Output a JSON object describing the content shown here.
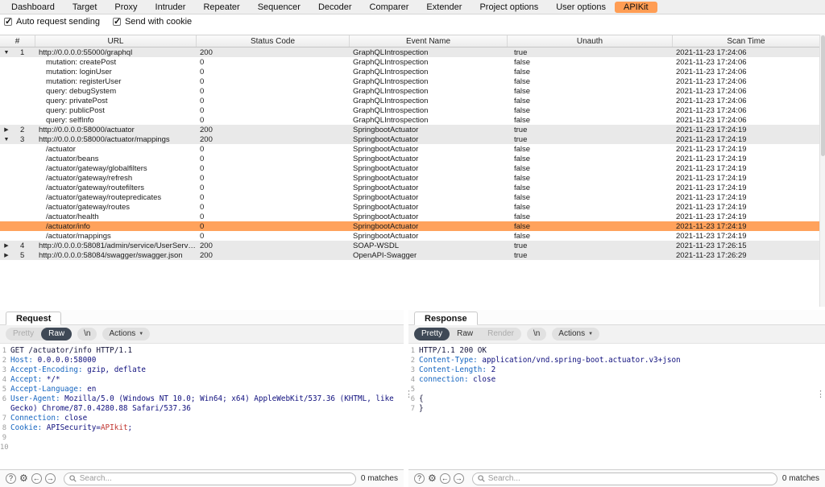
{
  "menu": {
    "tabs": [
      {
        "label": "Dashboard",
        "selected": false
      },
      {
        "label": "Target",
        "selected": false
      },
      {
        "label": "Proxy",
        "selected": false
      },
      {
        "label": "Intruder",
        "selected": false
      },
      {
        "label": "Repeater",
        "selected": false
      },
      {
        "label": "Sequencer",
        "selected": false
      },
      {
        "label": "Decoder",
        "selected": false
      },
      {
        "label": "Comparer",
        "selected": false
      },
      {
        "label": "Extender",
        "selected": false
      },
      {
        "label": "Project options",
        "selected": false
      },
      {
        "label": "User options",
        "selected": false
      },
      {
        "label": "APIKit",
        "selected": true
      }
    ]
  },
  "options": [
    {
      "label": "Auto request sending",
      "checked": true
    },
    {
      "label": "Send with cookie",
      "checked": true
    }
  ],
  "table": {
    "columns": [
      "#",
      "URL",
      "Status Code",
      "Event Name",
      "Unauth",
      "Scan Time"
    ],
    "rows": [
      {
        "expand": "down",
        "num": "1",
        "url": "http://0.0.0.0:55000/graphql",
        "status": "200",
        "event": "GraphQLIntrospection",
        "unauth": "true",
        "time": "2021-11-23 17:24:06",
        "kind": "parent"
      },
      {
        "expand": "",
        "num": "",
        "url": "mutation: createPost",
        "status": "0",
        "event": "GraphQLIntrospection",
        "unauth": "false",
        "time": "2021-11-23 17:24:06",
        "kind": "child"
      },
      {
        "expand": "",
        "num": "",
        "url": "mutation: loginUser",
        "status": "0",
        "event": "GraphQLIntrospection",
        "unauth": "false",
        "time": "2021-11-23 17:24:06",
        "kind": "child"
      },
      {
        "expand": "",
        "num": "",
        "url": "mutation: registerUser",
        "status": "0",
        "event": "GraphQLIntrospection",
        "unauth": "false",
        "time": "2021-11-23 17:24:06",
        "kind": "child"
      },
      {
        "expand": "",
        "num": "",
        "url": "query: debugSystem",
        "status": "0",
        "event": "GraphQLIntrospection",
        "unauth": "false",
        "time": "2021-11-23 17:24:06",
        "kind": "child"
      },
      {
        "expand": "",
        "num": "",
        "url": "query: privatePost",
        "status": "0",
        "event": "GraphQLIntrospection",
        "unauth": "false",
        "time": "2021-11-23 17:24:06",
        "kind": "child"
      },
      {
        "expand": "",
        "num": "",
        "url": "query: publicPost",
        "status": "0",
        "event": "GraphQLIntrospection",
        "unauth": "false",
        "time": "2021-11-23 17:24:06",
        "kind": "child"
      },
      {
        "expand": "",
        "num": "",
        "url": "query: selfInfo",
        "status": "0",
        "event": "GraphQLIntrospection",
        "unauth": "false",
        "time": "2021-11-23 17:24:06",
        "kind": "child"
      },
      {
        "expand": "right",
        "num": "2",
        "url": "http://0.0.0.0:58000/actuator",
        "status": "200",
        "event": "SpringbootActuator",
        "unauth": "true",
        "time": "2021-11-23 17:24:19",
        "kind": "parent"
      },
      {
        "expand": "down",
        "num": "3",
        "url": "http://0.0.0.0:58000/actuator/mappings",
        "status": "200",
        "event": "SpringbootActuator",
        "unauth": "true",
        "time": "2021-11-23 17:24:19",
        "kind": "parent"
      },
      {
        "expand": "",
        "num": "",
        "url": "/actuator",
        "status": "0",
        "event": "SpringbootActuator",
        "unauth": "false",
        "time": "2021-11-23 17:24:19",
        "kind": "child"
      },
      {
        "expand": "",
        "num": "",
        "url": "/actuator/beans",
        "status": "0",
        "event": "SpringbootActuator",
        "unauth": "false",
        "time": "2021-11-23 17:24:19",
        "kind": "child"
      },
      {
        "expand": "",
        "num": "",
        "url": "/actuator/gateway/globalfilters",
        "status": "0",
        "event": "SpringbootActuator",
        "unauth": "false",
        "time": "2021-11-23 17:24:19",
        "kind": "child"
      },
      {
        "expand": "",
        "num": "",
        "url": "/actuator/gateway/refresh",
        "status": "0",
        "event": "SpringbootActuator",
        "unauth": "false",
        "time": "2021-11-23 17:24:19",
        "kind": "child"
      },
      {
        "expand": "",
        "num": "",
        "url": "/actuator/gateway/routefilters",
        "status": "0",
        "event": "SpringbootActuator",
        "unauth": "false",
        "time": "2021-11-23 17:24:19",
        "kind": "child"
      },
      {
        "expand": "",
        "num": "",
        "url": "/actuator/gateway/routepredicates",
        "status": "0",
        "event": "SpringbootActuator",
        "unauth": "false",
        "time": "2021-11-23 17:24:19",
        "kind": "child"
      },
      {
        "expand": "",
        "num": "",
        "url": "/actuator/gateway/routes",
        "status": "0",
        "event": "SpringbootActuator",
        "unauth": "false",
        "time": "2021-11-23 17:24:19",
        "kind": "child"
      },
      {
        "expand": "",
        "num": "",
        "url": "/actuator/health",
        "status": "0",
        "event": "SpringbootActuator",
        "unauth": "false",
        "time": "2021-11-23 17:24:19",
        "kind": "child"
      },
      {
        "expand": "",
        "num": "",
        "url": "/actuator/info",
        "status": "0",
        "event": "SpringbootActuator",
        "unauth": "false",
        "time": "2021-11-23 17:24:19",
        "kind": "child",
        "selected": true
      },
      {
        "expand": "",
        "num": "",
        "url": "/actuator/mappings",
        "status": "0",
        "event": "SpringbootActuator",
        "unauth": "false",
        "time": "2021-11-23 17:24:19",
        "kind": "child"
      },
      {
        "expand": "right",
        "num": "4",
        "url": "http://0.0.0.0:58081/admin/service/UserServic...",
        "status": "200",
        "event": "SOAP-WSDL",
        "unauth": "true",
        "time": "2021-11-23 17:26:15",
        "kind": "parent"
      },
      {
        "expand": "right",
        "num": "5",
        "url": "http://0.0.0.0:58084/swagger/swagger.json",
        "status": "200",
        "event": "OpenAPI-Swagger",
        "unauth": "true",
        "time": "2021-11-23 17:26:29",
        "kind": "parent"
      }
    ]
  },
  "request_panel": {
    "tab_label": "Request",
    "toolbar": {
      "segments": [
        {
          "label": "Pretty",
          "state": "disabled"
        },
        {
          "label": "Raw",
          "state": "selected"
        }
      ],
      "buttons": [
        {
          "label": "\\n",
          "chevron": false
        },
        {
          "label": "Actions",
          "chevron": true
        }
      ]
    },
    "lines": [
      {
        "n": "1",
        "segs": [
          {
            "t": "GET /actuator/info HTTP/1.1",
            "c": "plain"
          }
        ]
      },
      {
        "n": "2",
        "segs": [
          {
            "t": "Host:",
            "c": "hname"
          },
          {
            "t": " 0.0.0.0:58000",
            "c": "hval"
          }
        ]
      },
      {
        "n": "3",
        "segs": [
          {
            "t": "Accept-Encoding:",
            "c": "hname"
          },
          {
            "t": " gzip, deflate",
            "c": "hval"
          }
        ]
      },
      {
        "n": "4",
        "segs": [
          {
            "t": "Accept:",
            "c": "hname"
          },
          {
            "t": " */*",
            "c": "hval"
          }
        ]
      },
      {
        "n": "5",
        "segs": [
          {
            "t": "Accept-Language:",
            "c": "hname"
          },
          {
            "t": " en",
            "c": "hval"
          }
        ]
      },
      {
        "n": "6",
        "segs": [
          {
            "t": "User-Agent:",
            "c": "hname"
          },
          {
            "t": " Mozilla/5.0 (Windows NT 10.0; Win64; x64) AppleWebKit/537.36 (KHTML, like Gecko) Chrome/87.0.4280.88 Safari/537.36",
            "c": "hval"
          }
        ]
      },
      {
        "n": "7",
        "segs": [
          {
            "t": "Connection:",
            "c": "hname"
          },
          {
            "t": " close",
            "c": "hval"
          }
        ]
      },
      {
        "n": "8",
        "segs": [
          {
            "t": "Cookie:",
            "c": "hname"
          },
          {
            "t": " APISecurity=",
            "c": "hval"
          },
          {
            "t": "APIkit",
            "c": "special"
          },
          {
            "t": ";",
            "c": "hval"
          }
        ]
      },
      {
        "n": "9",
        "segs": []
      },
      {
        "n": "10",
        "segs": []
      }
    ],
    "search": {
      "placeholder": "Search...",
      "matches": "0 matches"
    }
  },
  "response_panel": {
    "tab_label": "Response",
    "toolbar": {
      "segments": [
        {
          "label": "Pretty",
          "state": "selected"
        },
        {
          "label": "Raw",
          "state": "normal"
        },
        {
          "label": "Render",
          "state": "disabled"
        }
      ],
      "buttons": [
        {
          "label": "\\n",
          "chevron": false
        },
        {
          "label": "Actions",
          "chevron": true
        }
      ]
    },
    "lines": [
      {
        "n": "1",
        "segs": [
          {
            "t": "HTTP/1.1 200 OK",
            "c": "plain"
          }
        ]
      },
      {
        "n": "2",
        "segs": [
          {
            "t": "Content-Type:",
            "c": "hname"
          },
          {
            "t": " application/vnd.spring-boot.actuator.v3+json",
            "c": "hval"
          }
        ]
      },
      {
        "n": "3",
        "segs": [
          {
            "t": "Content-Length:",
            "c": "hname"
          },
          {
            "t": " 2",
            "c": "hval"
          }
        ]
      },
      {
        "n": "4",
        "segs": [
          {
            "t": "connection:",
            "c": "hname"
          },
          {
            "t": " close",
            "c": "hval"
          }
        ]
      },
      {
        "n": "5",
        "segs": []
      },
      {
        "n": "6",
        "segs": [
          {
            "t": "{",
            "c": "plain"
          }
        ]
      },
      {
        "n": "7",
        "segs": [
          {
            "t": "}",
            "c": "plain"
          }
        ]
      }
    ],
    "search": {
      "placeholder": "Search...",
      "matches": "0 matches"
    }
  },
  "colors": {
    "selected_tab": "#ff9d54",
    "selected_row": "#ffa25c",
    "parent_row": "#e9e9e9",
    "segment_selected": "#3f4956",
    "header_name_text": "#1565c0",
    "header_value_text": "#10107e",
    "cookie_value_text": "#c03530"
  }
}
